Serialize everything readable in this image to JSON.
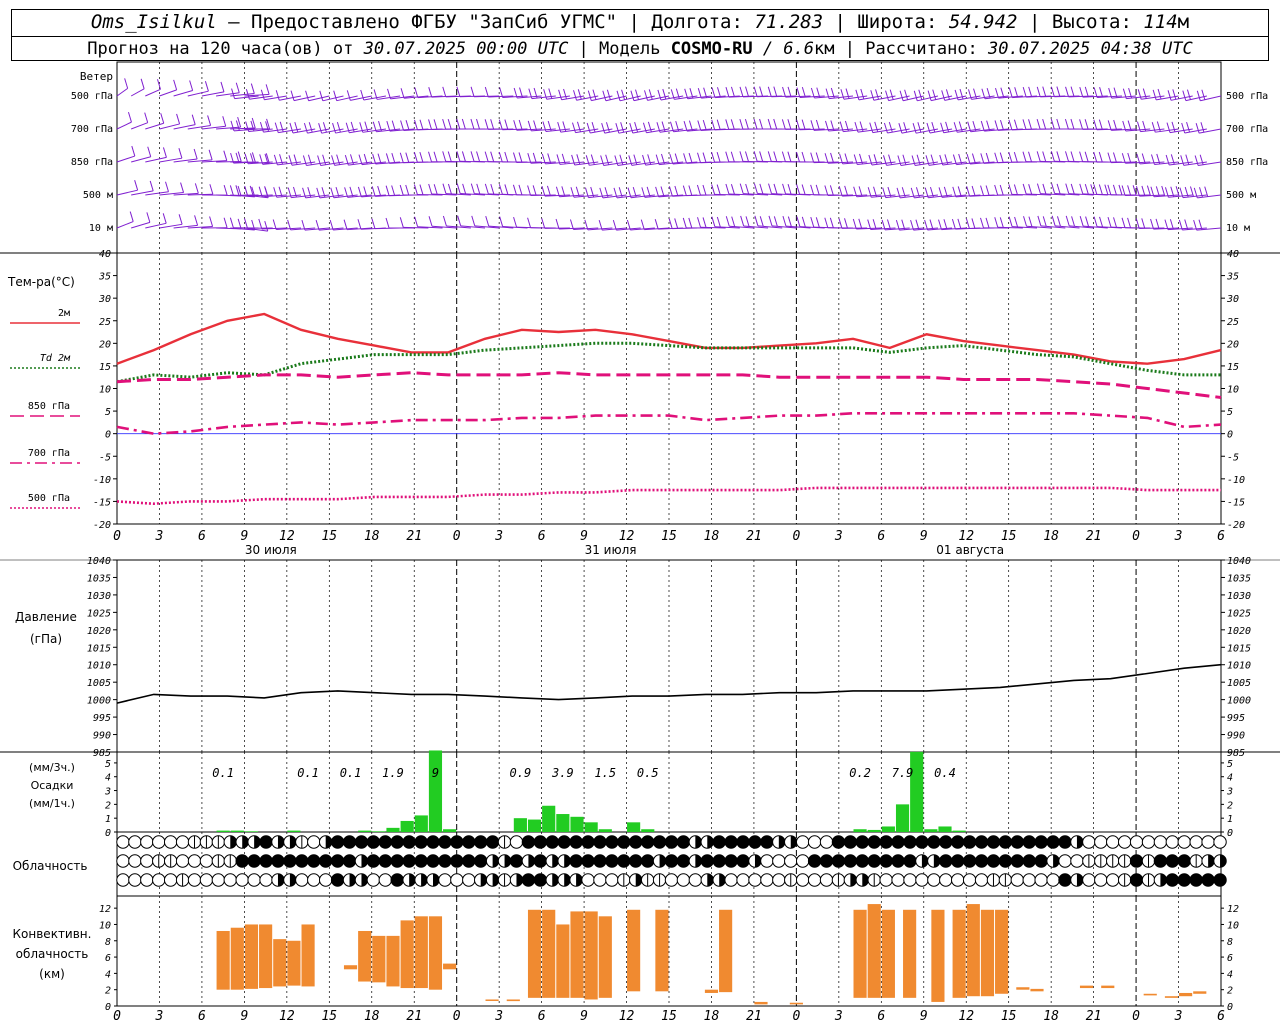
{
  "header": {
    "station": "Oms_Isilkul",
    "dash": " – ",
    "provider": "Предоставлено ФГБУ \"ЗапСиб УГМС\"",
    "sep": " | ",
    "lon_label": "Долгота: ",
    "lon_value": "71.283",
    "lat_label": "Широта: ",
    "lat_value": "54.942",
    "alt_label": "Высота: ",
    "alt_value": "114",
    "alt_unit": "м",
    "forecast_prefix": "Прогноз на 120 часа(ов) от ",
    "forecast_time": "30.07.2025 00:00 UTC",
    "model_label": "Модель ",
    "model_name": "COSMO-RU",
    "model_res": " / 6.6",
    "model_unit": "км",
    "calc_label": "Рассчитано: ",
    "calc_time": "30.07.2025 04:38 UTC"
  },
  "colors": {
    "t2m": "#e8303a",
    "td2m": "#1a7a1a",
    "t850": "#e0107a",
    "t700": "#e0107a",
    "t500": "#e0107a",
    "wind": "#8020d0",
    "precip": "#22cc22",
    "conv": "#f08a30",
    "zero_line": "#3030ff"
  },
  "chart_data": [
    {
      "type": "line",
      "title": "Ветер",
      "levels": [
        "500 гПа",
        "700 гПа",
        "850 гПа",
        "500 м",
        "10 м"
      ],
      "note": "wind barbs per level"
    },
    {
      "type": "line",
      "ylabel": "Тем-ра(°C)",
      "ylim": [
        -20,
        40
      ],
      "yticks": [
        40,
        35,
        30,
        25,
        20,
        15,
        10,
        5,
        0,
        -5,
        -10,
        -15,
        -20
      ],
      "x_hours": [
        0,
        3,
        6,
        9,
        12,
        15,
        18,
        21,
        24,
        27,
        30,
        33,
        36,
        39,
        42,
        45,
        48,
        51,
        54,
        57,
        60,
        63,
        66,
        69,
        72,
        75,
        78
      ],
      "x_tick_labels": [
        "0",
        "3",
        "6",
        "9",
        "12",
        "15",
        "18",
        "21",
        "0",
        "3",
        "6",
        "9",
        "12",
        "15",
        "18",
        "21",
        "0",
        "3",
        "6",
        "9",
        "12",
        "15",
        "18",
        "21",
        "0",
        "3",
        "6"
      ],
      "day_labels": [
        "30 июля",
        "31 июля",
        "01 августа"
      ],
      "series": [
        {
          "name": "2м",
          "style": "solid",
          "y": [
            15.5,
            18.5,
            22,
            25,
            26.5,
            23,
            21,
            19.5,
            18,
            18,
            21,
            23,
            22.5,
            23,
            22,
            20.5,
            19,
            19,
            19.5,
            20,
            21,
            19,
            22,
            20.5,
            19.5,
            18.5,
            17.5,
            16,
            15.5,
            16.5,
            18.5
          ]
        },
        {
          "name": "Td 2м",
          "style": "dotted",
          "y": [
            11.5,
            13,
            12.5,
            13.5,
            13,
            15.5,
            16.5,
            17.5,
            17.5,
            17.5,
            18.5,
            19,
            19.5,
            20,
            20,
            19.5,
            19,
            19,
            19,
            19,
            19,
            18,
            19,
            19.5,
            18.5,
            17.5,
            17,
            15.5,
            14,
            13,
            13
          ]
        },
        {
          "name": "850 гПа",
          "style": "dashed",
          "y": [
            11.5,
            12,
            12,
            12.5,
            13,
            13,
            12.5,
            13,
            13.5,
            13,
            13,
            13,
            13.5,
            13,
            13,
            13,
            13,
            13,
            12.5,
            12.5,
            12.5,
            12.5,
            12.5,
            12,
            12,
            12,
            11.5,
            11,
            10,
            9,
            8
          ]
        },
        {
          "name": "700 гПа",
          "style": "dashdot",
          "y": [
            1.5,
            0,
            0.5,
            1.5,
            2,
            2.5,
            2,
            2.5,
            3,
            3,
            3,
            3.5,
            3.5,
            4,
            4,
            4,
            3,
            3.5,
            4,
            4,
            4.5,
            4.5,
            4.5,
            4.5,
            4.5,
            4.5,
            4.5,
            4,
            3.5,
            1.5,
            2
          ]
        },
        {
          "name": "500 гПа",
          "style": "dotted",
          "y": [
            -15,
            -15.5,
            -15,
            -15,
            -14.5,
            -14.5,
            -14.5,
            -14,
            -14,
            -14,
            -13.5,
            -13.5,
            -13,
            -13,
            -12.5,
            -12.5,
            -12.5,
            -12.5,
            -12.5,
            -12,
            -12,
            -12,
            -12,
            -12,
            -12,
            -12,
            -12,
            -12,
            -12.5,
            -12.5,
            -12.5
          ]
        }
      ]
    },
    {
      "type": "line",
      "ylabel": "Давление",
      "yunit": "(гПа)",
      "ylim": [
        985,
        1040
      ],
      "yticks": [
        1040,
        1035,
        1030,
        1025,
        1020,
        1015,
        1010,
        1005,
        1000,
        995,
        990,
        985
      ],
      "series": [
        {
          "name": "pressure",
          "y": [
            999,
            1001.5,
            1001,
            1001,
            1000.5,
            1002,
            1002.5,
            1002,
            1001.5,
            1001.5,
            1001,
            1000.5,
            1000,
            1000.5,
            1001,
            1001,
            1001.5,
            1001.5,
            1002,
            1002,
            1002.5,
            1002.5,
            1002.5,
            1003,
            1003.5,
            1004.5,
            1005.5,
            1006,
            1007.5,
            1009,
            1010
          ]
        }
      ]
    },
    {
      "type": "bar",
      "ylabel": "(мм/3ч.)",
      "title": "Осадки",
      "yunit": "(мм/1ч.)",
      "ylim": [
        0,
        5.5
      ],
      "yticks": [
        "5",
        "4",
        "3",
        "2",
        "1",
        "0"
      ],
      "bars_hourly": [
        [
          7,
          0.1
        ],
        [
          8,
          0.1
        ],
        [
          9,
          0.05
        ],
        [
          12,
          0.1
        ],
        [
          17,
          0.1
        ],
        [
          18,
          0.05
        ],
        [
          19,
          0.3
        ],
        [
          20,
          0.8
        ],
        [
          21,
          1.2
        ],
        [
          22,
          5.9
        ],
        [
          23,
          0.2
        ],
        [
          28,
          1.0
        ],
        [
          29,
          0.9
        ],
        [
          30,
          1.9
        ],
        [
          31,
          1.3
        ],
        [
          32,
          1.1
        ],
        [
          33,
          0.7
        ],
        [
          34,
          0.2
        ],
        [
          36,
          0.7
        ],
        [
          37,
          0.2
        ],
        [
          52,
          0.2
        ],
        [
          53,
          0.15
        ],
        [
          54,
          0.4
        ],
        [
          55,
          2.0
        ],
        [
          56,
          5.8
        ],
        [
          57,
          0.2
        ],
        [
          58,
          0.4
        ],
        [
          59,
          0.1
        ]
      ],
      "labels": [
        {
          "h": 7.5,
          "text": "0.1"
        },
        {
          "h": 13.5,
          "text": "0.1"
        },
        {
          "h": 16.5,
          "text": "0.1"
        },
        {
          "h": 19.5,
          "text": "1.9"
        },
        {
          "h": 22.5,
          "text": "9"
        },
        {
          "h": 28.5,
          "text": "0.9"
        },
        {
          "h": 31.5,
          "text": "3.9"
        },
        {
          "h": 34.5,
          "text": "1.5"
        },
        {
          "h": 37.5,
          "text": "0.5"
        },
        {
          "h": 52.5,
          "text": "0.2"
        },
        {
          "h": 55.5,
          "text": "7.9"
        },
        {
          "h": 58.5,
          "text": "0.4"
        }
      ]
    },
    {
      "type": "table",
      "title": "Облачность",
      "rows": [
        "000000111222322102333333333333331033333333333333223333322000333333333333333333332000000000000",
        "000110001133333333332333333333322323223333333233233332000033333333322333333333200111131333122",
        "000001000000022000322003222000221233222000121100022000001000122100000000011000032000131233333"
      ]
    },
    {
      "type": "bar",
      "ylabel": "Конвективн.",
      "title": "облачность",
      "yunit": "(км)",
      "ylim": [
        0,
        13
      ],
      "yticks": [
        "12",
        "10",
        "8",
        "6",
        "4",
        "2",
        "0"
      ],
      "bars": [
        [
          7.5,
          2,
          9.2
        ],
        [
          8.5,
          2,
          9.6
        ],
        [
          9.5,
          2.1,
          10
        ],
        [
          10.5,
          2.2,
          10
        ],
        [
          11.5,
          2.4,
          8.2
        ],
        [
          12.5,
          2.5,
          8
        ],
        [
          13.5,
          2.4,
          10
        ],
        [
          16.5,
          4.5,
          5
        ],
        [
          17.5,
          3,
          9.2
        ],
        [
          18.5,
          2.9,
          8.6
        ],
        [
          19.5,
          2.4,
          8.6
        ],
        [
          20.5,
          2.2,
          10.5
        ],
        [
          21.5,
          2.2,
          11
        ],
        [
          22.5,
          2,
          11
        ],
        [
          23.5,
          4.5,
          5.2
        ],
        [
          26.5,
          0.7,
          0.8
        ],
        [
          28,
          0.6,
          0.8
        ],
        [
          29.5,
          1,
          11.8
        ],
        [
          30.5,
          1,
          11.8
        ],
        [
          31.5,
          1,
          10
        ],
        [
          32.5,
          1,
          11.6
        ],
        [
          33.5,
          0.8,
          11.6
        ],
        [
          34.5,
          1,
          11
        ],
        [
          36.5,
          1.8,
          11.8
        ],
        [
          38.5,
          1.8,
          11.8
        ],
        [
          42,
          1.6,
          2
        ],
        [
          43,
          1.7,
          11.8
        ],
        [
          45.5,
          0.2,
          0.5
        ],
        [
          48,
          0.2,
          0.4
        ],
        [
          52.5,
          1,
          11.8
        ],
        [
          53.5,
          1,
          12.5
        ],
        [
          54.5,
          1,
          11.8
        ],
        [
          56,
          1,
          11.8
        ],
        [
          58,
          0.5,
          11.8
        ],
        [
          59.5,
          1,
          11.8
        ],
        [
          60.5,
          1.2,
          12.5
        ],
        [
          61.5,
          1.2,
          11.8
        ],
        [
          62.5,
          1.5,
          11.8
        ],
        [
          64,
          2,
          2.3
        ],
        [
          65,
          1.8,
          2.1
        ],
        [
          68.5,
          2.2,
          2.5
        ],
        [
          70,
          2.2,
          2.5
        ],
        [
          73,
          1.3,
          1.5
        ],
        [
          74.5,
          1,
          1.2
        ],
        [
          75.5,
          1.2,
          1.6
        ],
        [
          76.5,
          1.5,
          1.8
        ]
      ]
    }
  ]
}
